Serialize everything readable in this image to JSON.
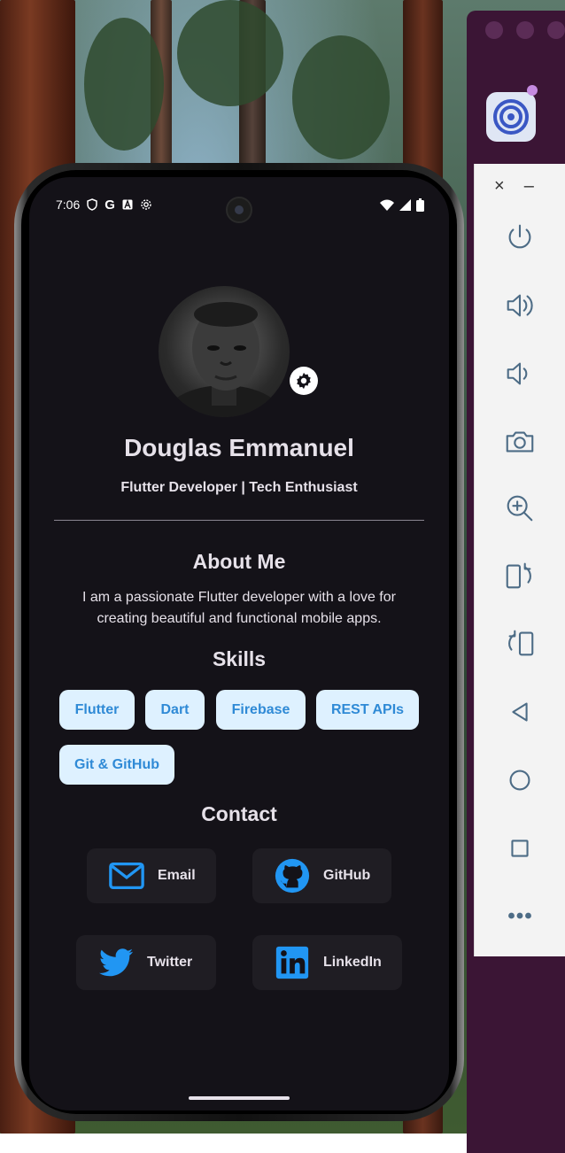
{
  "status_bar": {
    "time": "7:06"
  },
  "profile": {
    "name": "Douglas Emmanuel",
    "tagline": "Flutter Developer | Tech Enthusiast"
  },
  "about": {
    "title": "About Me",
    "text": "I am a passionate Flutter developer with a love for creating beautiful and functional mobile apps."
  },
  "skills": {
    "title": "Skills",
    "items": [
      "Flutter",
      "Dart",
      "Firebase",
      "REST APIs",
      "Git & GitHub"
    ]
  },
  "contact": {
    "title": "Contact",
    "items": [
      {
        "label": "Email",
        "icon": "email-icon"
      },
      {
        "label": "GitHub",
        "icon": "github-icon"
      },
      {
        "label": "Twitter",
        "icon": "twitter-icon"
      },
      {
        "label": "LinkedIn",
        "icon": "linkedin-icon"
      }
    ]
  },
  "emulator_toolbar": {
    "close": "×",
    "minimize": "–",
    "buttons": [
      "power-icon",
      "volume-up-icon",
      "volume-down-icon",
      "camera-icon",
      "zoom-icon",
      "rotate-left-icon",
      "rotate-right-icon",
      "back-icon",
      "home-icon",
      "overview-icon",
      "more-icon"
    ]
  },
  "colors": {
    "screen_bg": "#141218",
    "chip_bg": "#def1ff",
    "chip_text": "#2f8ad6",
    "icon_blue": "#2196f3",
    "card_bg": "#1f1d23"
  }
}
